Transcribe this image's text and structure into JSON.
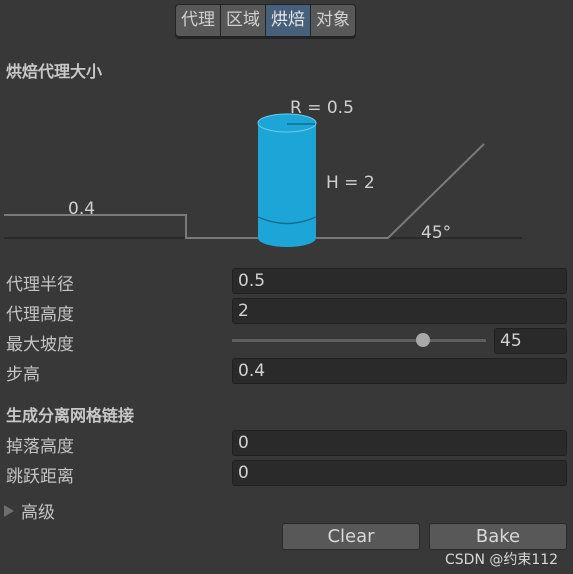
{
  "tabs": [
    {
      "label": "代理",
      "active": false
    },
    {
      "label": "区域",
      "active": false
    },
    {
      "label": "烘焙",
      "active": true
    },
    {
      "label": "对象",
      "active": false
    }
  ],
  "bake_agent_size": {
    "title": "烘焙代理大小",
    "diagram": {
      "radius_label": "R = 0.5",
      "height_label": "H = 2",
      "step_label": "0.4",
      "slope_label": "45°",
      "colors": {
        "cylinder": "#1ea5d8",
        "ground": "#7a7a7a"
      }
    },
    "fields": {
      "agent_radius": {
        "label": "代理半径",
        "value": "0.5"
      },
      "agent_height": {
        "label": "代理高度",
        "value": "2"
      },
      "max_slope": {
        "label": "最大坡度",
        "value": "45",
        "min": 0,
        "max": 60
      },
      "step_height": {
        "label": "步高",
        "value": "0.4"
      }
    }
  },
  "offmesh_links": {
    "title": "生成分离网格链接",
    "fields": {
      "drop_height": {
        "label": "掉落高度",
        "value": "0"
      },
      "jump_distance": {
        "label": "跳跃距离",
        "value": "0"
      }
    }
  },
  "advanced": {
    "label": "高级",
    "expanded": false
  },
  "buttons": {
    "clear": "Clear",
    "bake": "Bake"
  },
  "watermark": "CSDN @约束112"
}
